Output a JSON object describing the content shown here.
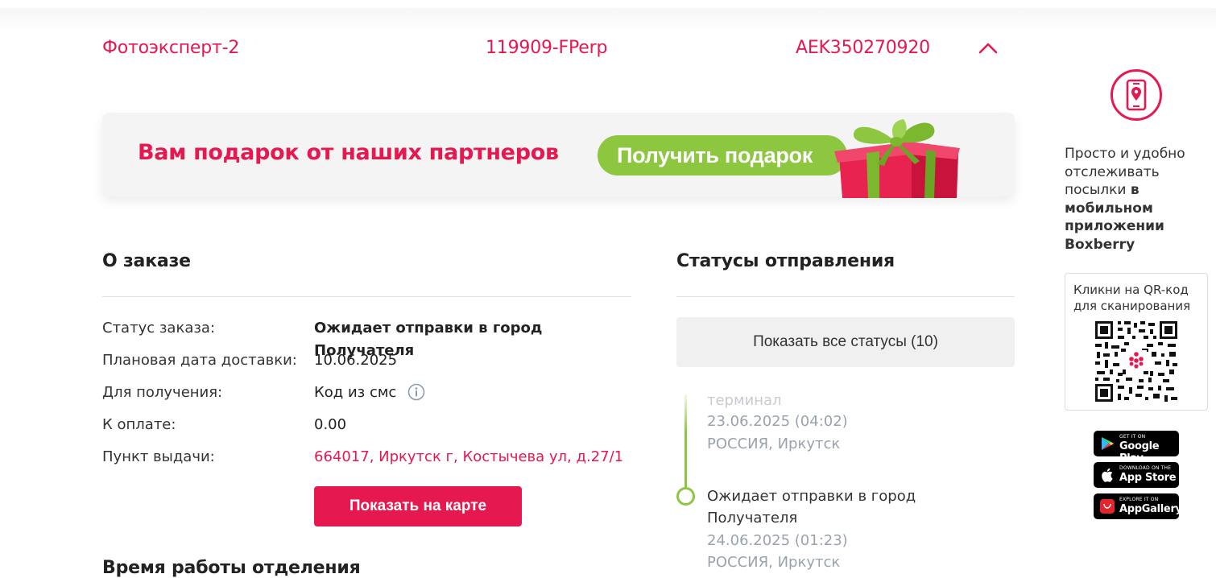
{
  "header": {
    "sender": "Фотоэксперт-2",
    "order_code": "119909-FPerp",
    "tracking_number": "AEK350270920"
  },
  "promo": {
    "title": "Вам подарок от наших партнеров",
    "button_label": "Получить подарок"
  },
  "order": {
    "title": "О заказе",
    "rows": [
      {
        "label": "Статус заказа:",
        "value": "Ожидает отправки в город Получателя"
      },
      {
        "label": "Плановая дата доставки:",
        "value": "10.06.2025"
      },
      {
        "label": "Для получения:",
        "value": "Код из смс"
      },
      {
        "label": "К оплате:",
        "value": "0.00"
      },
      {
        "label": "Пункт выдачи:",
        "value": "664017, Иркутск г, Костычева ул, д.27/1"
      }
    ],
    "map_button": "Показать на карте",
    "work_hours_title": "Время работы отделения"
  },
  "statuses": {
    "title": "Статусы отправления",
    "show_all_button": "Показать все статусы (10)",
    "items": [
      {
        "name": "терминал",
        "date": "23.06.2025 (04:02)",
        "place": "РОССИЯ, Иркутск"
      },
      {
        "name_line1": "Ожидает отправки в город",
        "name_line2": "Получателя",
        "date": "24.06.2025 (01:23)",
        "place": "РОССИЯ, Иркутск"
      }
    ]
  },
  "sidebar": {
    "text_plain": "Просто и удобно отслеживать посылки ",
    "text_bold": "в мобильном приложении Boxberry",
    "qr_caption": "Кликни на QR-код для сканирования",
    "stores": [
      {
        "small": "GET IT ON",
        "big": "Google Play",
        "icon": "google-play-icon"
      },
      {
        "small": "Download on the",
        "big": "App Store",
        "icon": "apple-icon"
      },
      {
        "small": "EXPLORE IT ON",
        "big": "AppGallery",
        "icon": "huawei-icon"
      }
    ]
  },
  "colors": {
    "brand": "#e5194f",
    "accent_green": "#8dc63f"
  }
}
